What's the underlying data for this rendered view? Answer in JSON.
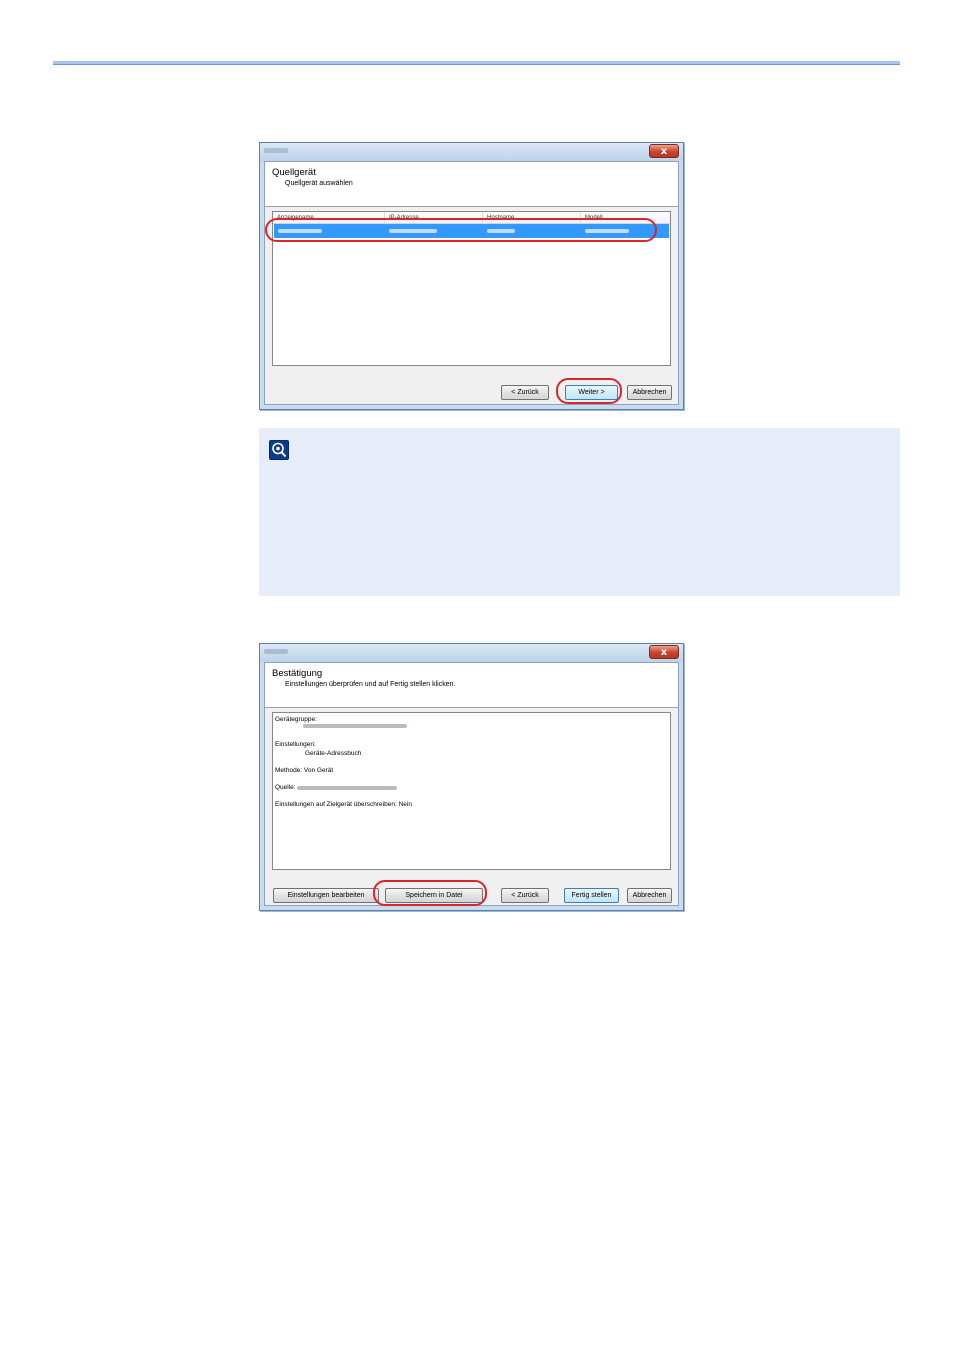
{
  "dialog1": {
    "header_title": "Quellgerät",
    "header_subtitle": "Quellgerät auswählen",
    "columns": [
      "Anzeigename",
      "IP-Adresse",
      "Hostname",
      "Modell"
    ],
    "buttons": {
      "back": "< Zurück",
      "next": "Weiter >",
      "cancel": "Abbrechen"
    },
    "close": "x"
  },
  "note": {
    "icon": "note-lightbulb-icon"
  },
  "dialog2": {
    "header_title": "Bestätigung",
    "header_subtitle": "Einstellungen überprüfen und auf Fertig stellen klicken.",
    "summary": {
      "device_group_label": "Gerätegruppe:",
      "settings_label": "Einstellungen:",
      "settings_value": "Geräte-Adressbuch",
      "method": "Methode: Von Gerät",
      "source_label": "Quelle:",
      "overwrite": "Einstellungen auf Zielgerät überschreiben: Nein"
    },
    "buttons": {
      "edit": "Einstellungen bearbeiten",
      "save": "Speichern in Datei",
      "back": "< Zurück",
      "finish": "Fertig stellen",
      "cancel": "Abbrechen"
    },
    "close": "x"
  },
  "colors": {
    "accent_rule": "#a9c4ea",
    "highlight_ring": "#d9262c",
    "selection": "#3399ff",
    "note_bg": "#e6edf9"
  }
}
